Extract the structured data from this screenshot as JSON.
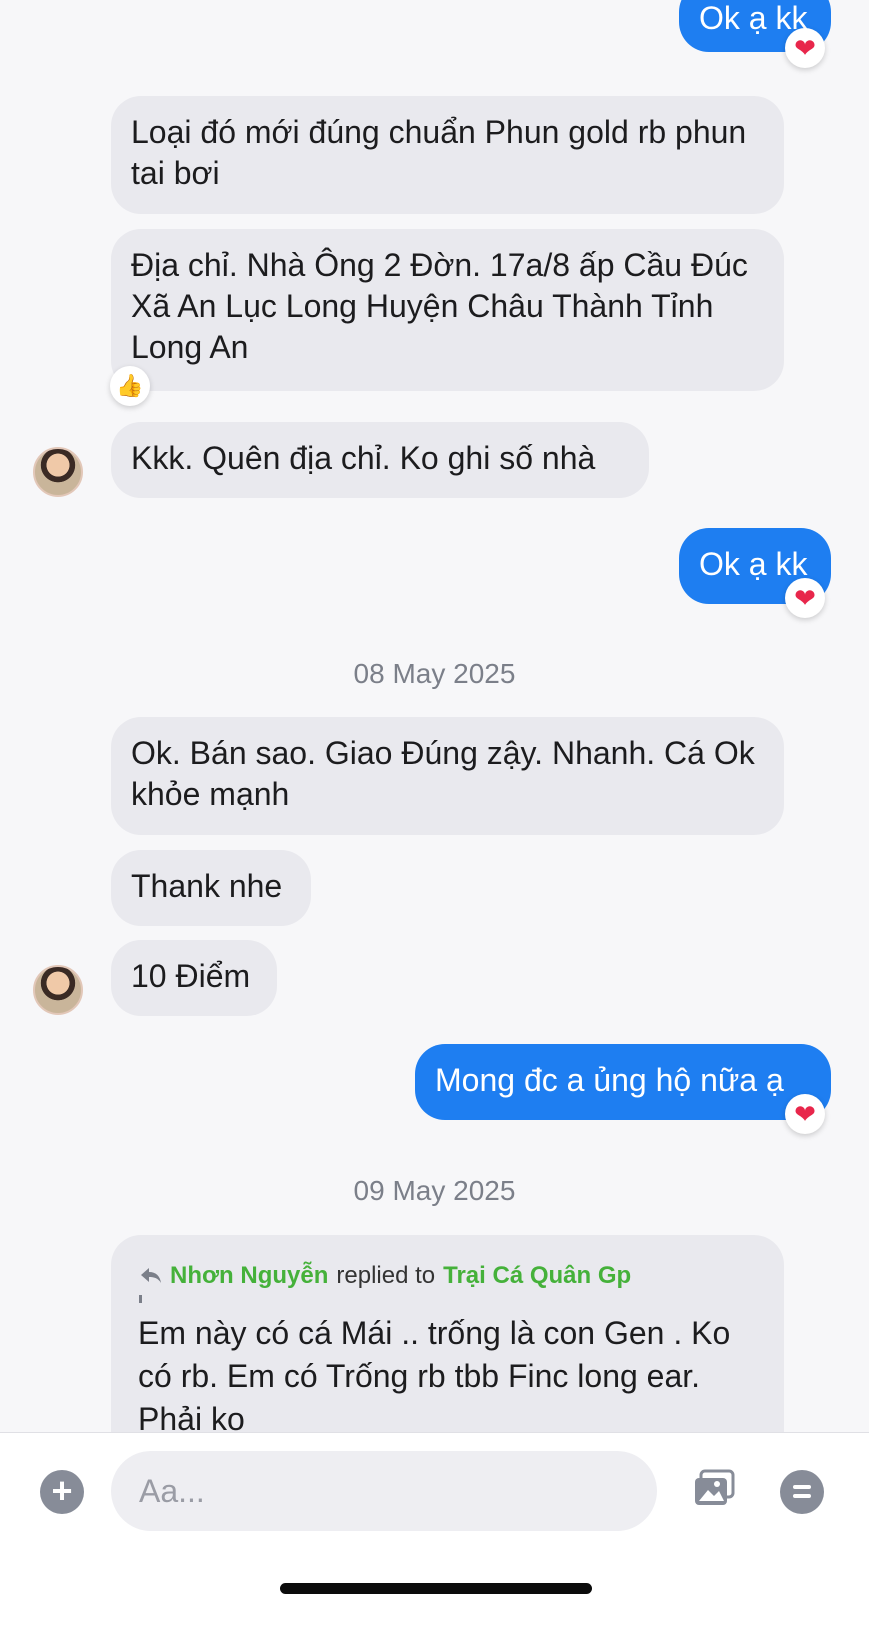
{
  "messages": {
    "m1": "Ok ạ kk",
    "m2": "Loại đó mới đúng chuẩn Phun gold rb phun tai bơi",
    "m3": "Địa chỉ. Nhà Ông 2 Đờn. 17a/8 ấp Cầu Đúc Xã An Lục Long Huyện Châu Thành Tỉnh Long An",
    "m4": "Kkk. Quên địa chỉ. Ko ghi số nhà",
    "m5": "Ok ạ kk",
    "date1": "08 May 2025",
    "m6": "Ok. Bán sao. Giao Đúng zậy. Nhanh. Cá Ok khỏe mạnh",
    "m7": "Thank nhe",
    "m8": "10 Điểm",
    "m9": "Mong đc a ủng hộ nữa ạ",
    "date2": "09 May 2025",
    "reply_from": "Nhơn Nguyễn",
    "reply_mid": "replied to",
    "reply_to": "Trại Cá Quân Gp",
    "m10": "Em này có cá Mái .. trống là con Gen . Ko có rb. Em có Trống rb tbb Finc long ear. Phải ko"
  },
  "reactions": {
    "heart": "❤",
    "thumbs": "👍"
  },
  "composer": {
    "plus": "+",
    "placeholder": "Aa..."
  },
  "colors": {
    "outgoing": "#1e7ef1",
    "incoming": "#e9e9ee",
    "reply_name": "#45b13a"
  }
}
